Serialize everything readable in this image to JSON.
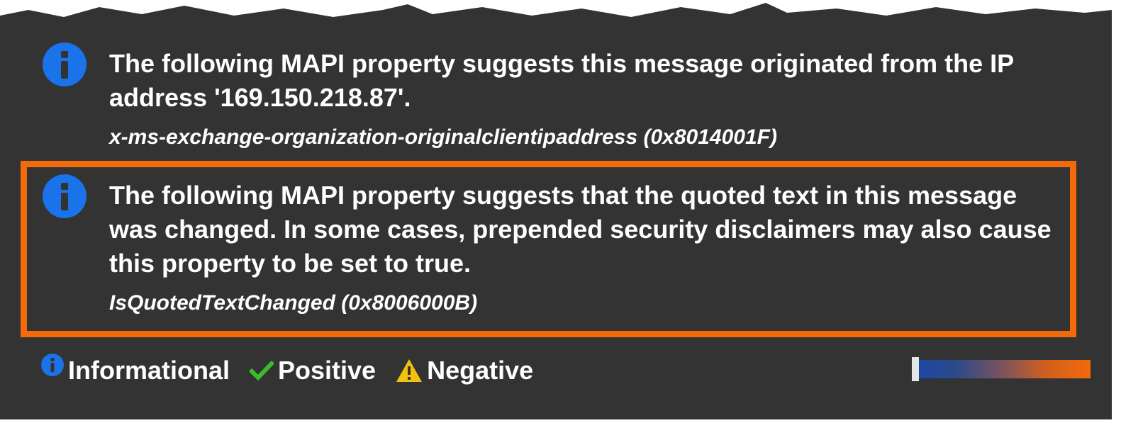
{
  "entries": [
    {
      "icon": "info-icon",
      "message": "The following MAPI property suggests this message originated from the IP address '169.150.218.87'.",
      "property": "x-ms-exchange-organization-originalclientipaddress (0x8014001F)"
    },
    {
      "icon": "info-icon",
      "message": "The following MAPI property suggests that the quoted text in this message was changed. In some cases, prepended security disclaimers may also cause this property to be set to true.",
      "property": "IsQuotedTextChanged (0x8006000B)",
      "highlighted": true
    }
  ],
  "legend": {
    "informational": "Informational",
    "positive": "Positive",
    "negative": "Negative"
  },
  "colors": {
    "background": "#333333",
    "info_blue": "#1a73e8",
    "positive_green": "#3cba2e",
    "negative_yellow": "#f4c20d",
    "highlight_orange": "#f26a0a"
  }
}
